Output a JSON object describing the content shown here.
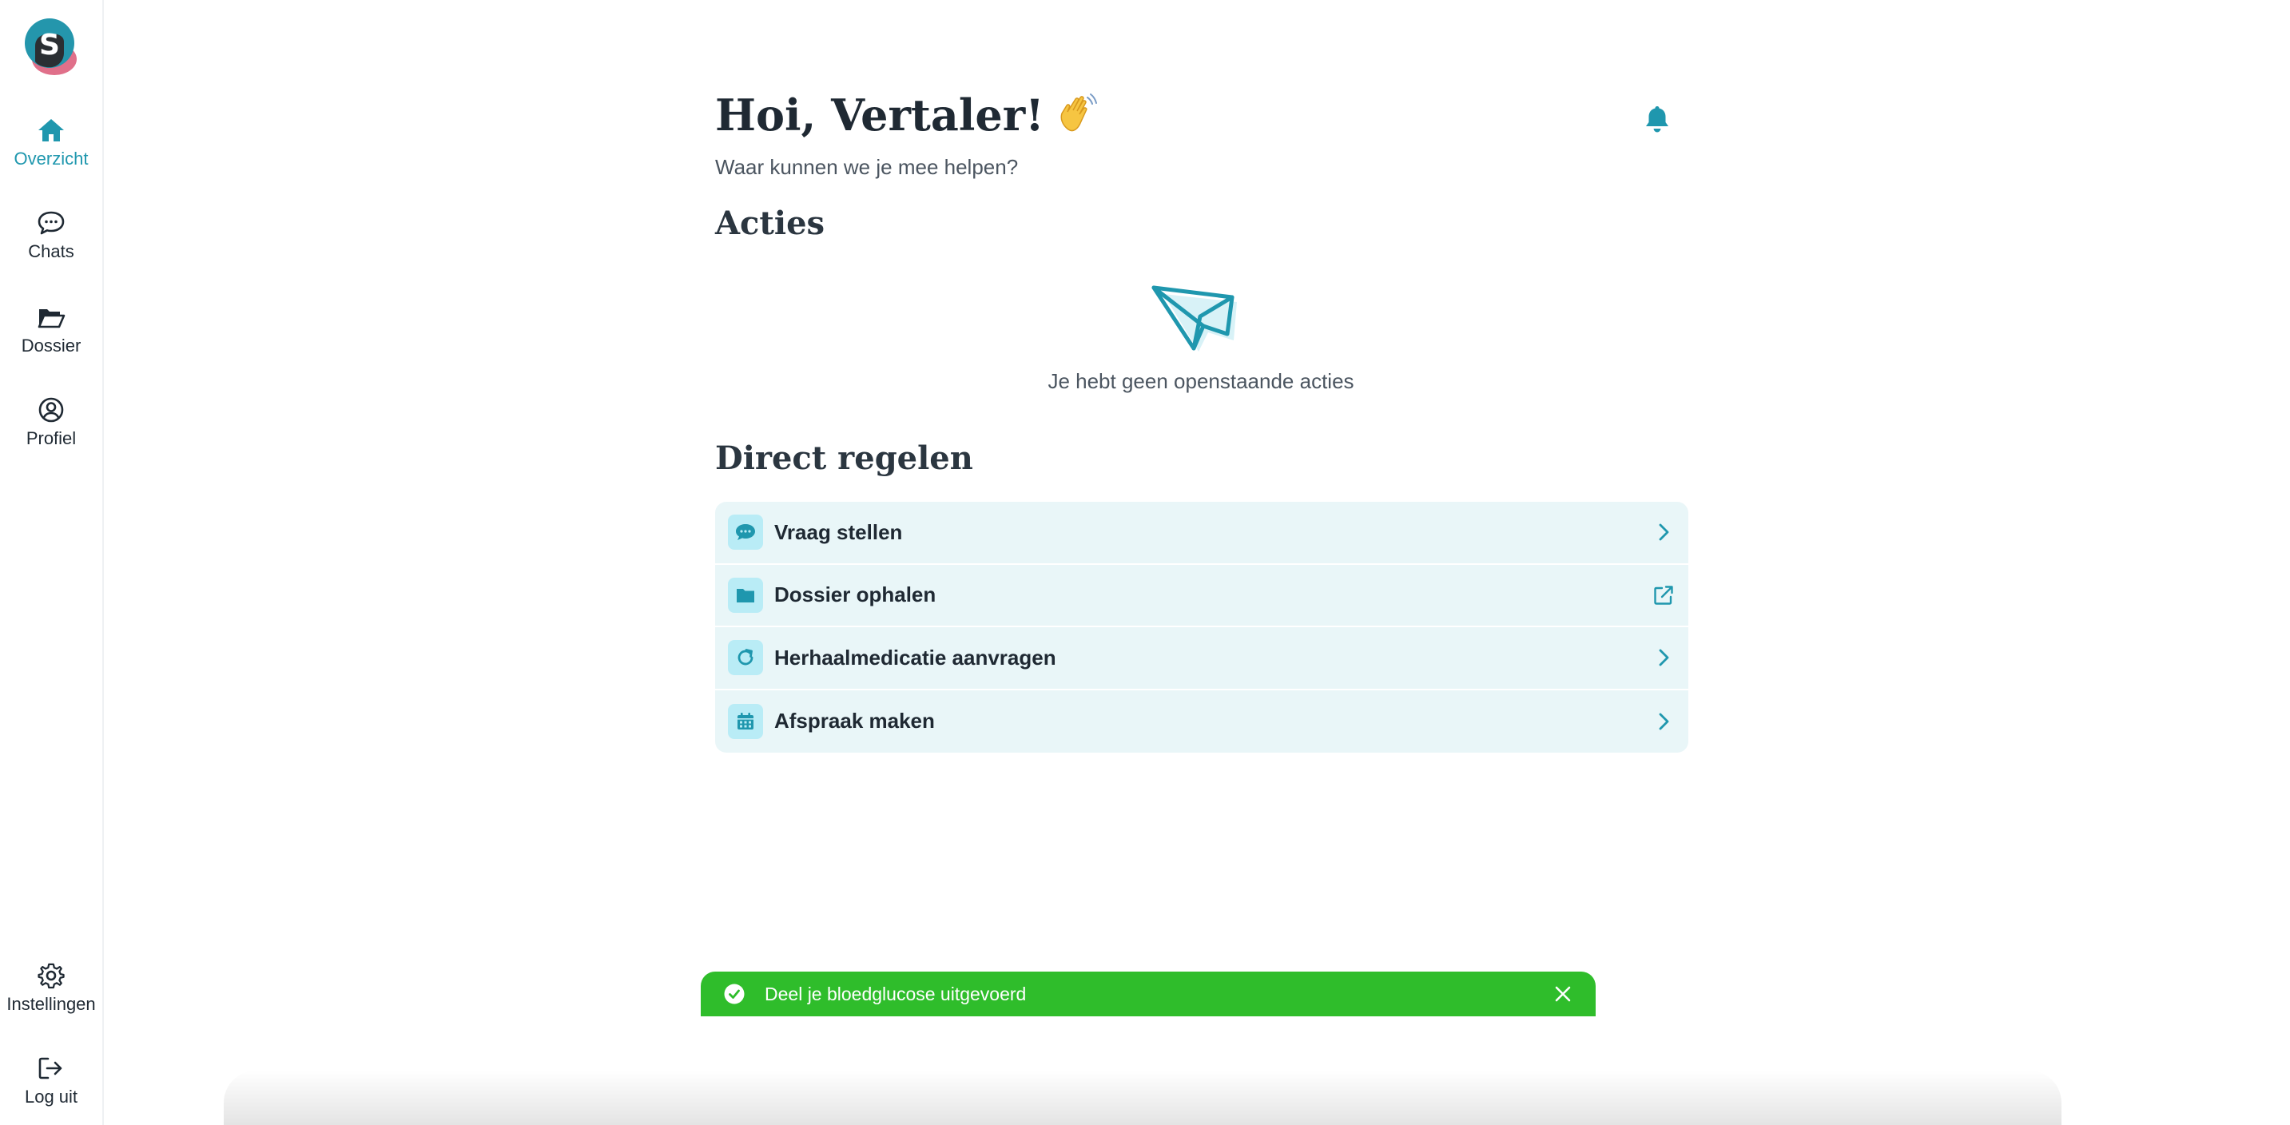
{
  "colors": {
    "accent": "#1f97ae",
    "toast_bg": "#2fbd2b",
    "list_bg": "#e9f6f8",
    "icon_bg": "#b9ecf6"
  },
  "sidebar": {
    "logo_icon": "s-logo-icon",
    "items": [
      {
        "label": "Overzicht",
        "icon": "home-icon",
        "active": true
      },
      {
        "label": "Chats",
        "icon": "chat-bubble-icon"
      },
      {
        "label": "Dossier",
        "icon": "folder-open-icon"
      },
      {
        "label": "Profiel",
        "icon": "user-circle-icon"
      }
    ],
    "bottom_items": [
      {
        "label": "Instellingen",
        "icon": "gear-icon"
      },
      {
        "label": "Log uit",
        "icon": "logout-icon"
      }
    ]
  },
  "header": {
    "greeting": "Hoi, Vertaler!",
    "emoji": "waving-hand-icon",
    "subtitle": "Waar kunnen we je mee helpen?",
    "bell_icon": "bell-icon"
  },
  "acties": {
    "heading": "Acties",
    "empty_icon": "paper-plane-icon",
    "empty_text": "Je hebt geen openstaande acties"
  },
  "direct": {
    "heading": "Direct regelen",
    "items": [
      {
        "label": "Vraag stellen",
        "icon": "chat-dots-icon",
        "trail": "chevron-right-icon"
      },
      {
        "label": "Dossier ophalen",
        "icon": "folder-icon",
        "trail": "external-link-icon"
      },
      {
        "label": "Herhaalmedicatie aanvragen",
        "icon": "refresh-icon",
        "trail": "chevron-right-icon"
      },
      {
        "label": "Afspraak maken",
        "icon": "calendar-icon",
        "trail": "chevron-right-icon"
      }
    ]
  },
  "toast": {
    "text": "Deel je bloedglucose uitgevoerd",
    "icon": "check-circle-icon",
    "close_icon": "close-icon"
  }
}
